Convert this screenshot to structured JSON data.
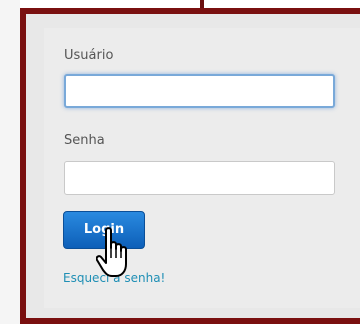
{
  "login_form": {
    "username_label": "Usuário",
    "username_value": "",
    "password_label": "Senha",
    "password_value": "",
    "login_button": "Login",
    "forgot_link": "Esqueci a senha!"
  },
  "colors": {
    "frame_border": "#7a1010",
    "button": "#1a72cc",
    "link": "#1f8fb5"
  },
  "icons": {
    "cursor": "hand-pointer-icon"
  }
}
